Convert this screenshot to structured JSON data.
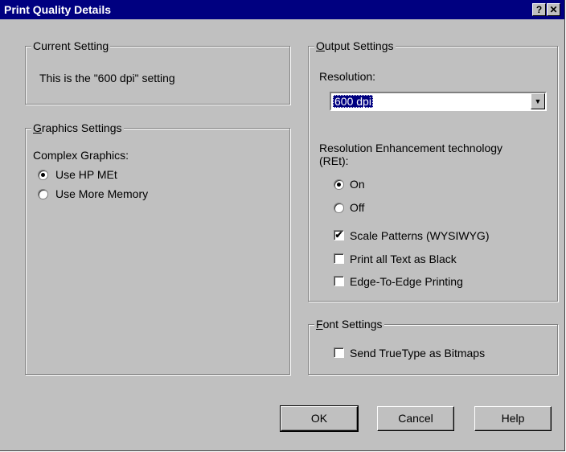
{
  "window": {
    "title": "Print Quality Details",
    "help_button": "?",
    "close_button": "✕"
  },
  "current_setting": {
    "legend": "Current Setting",
    "text": "This is the \"600 dpi\" setting"
  },
  "graphics_settings": {
    "legend_first": "G",
    "legend_rest": "raphics Settings",
    "label": "Complex Graphics:",
    "options": [
      {
        "label": "Use HP MEt",
        "selected": true
      },
      {
        "label": "Use More Memory",
        "selected": false
      }
    ]
  },
  "output_settings": {
    "legend_first": "O",
    "legend_rest": "utput Settings",
    "resolution_label": "Resolution:",
    "resolution_value": "600 dpi",
    "ret_label_line1": "Resolution Enhancement technology",
    "ret_label_line2": "(REt):",
    "ret_options": [
      {
        "label": "On",
        "selected": true
      },
      {
        "label": "Off",
        "selected": false
      }
    ],
    "checkboxes": [
      {
        "label": "Scale Patterns (WYSIWYG)",
        "checked": true
      },
      {
        "label": "Print all Text as Black",
        "checked": false
      },
      {
        "label": "Edge-To-Edge Printing",
        "checked": false
      }
    ]
  },
  "font_settings": {
    "legend_first": "F",
    "legend_rest": "ont Settings",
    "checkbox": {
      "label": "Send TrueType as Bitmaps",
      "checked": false
    }
  },
  "buttons": {
    "ok": "OK",
    "cancel": "Cancel",
    "help": "Help"
  },
  "icons": {
    "radio_selected": "radio-dot",
    "check_mark": "✔",
    "dropdown_arrow": "▼"
  }
}
